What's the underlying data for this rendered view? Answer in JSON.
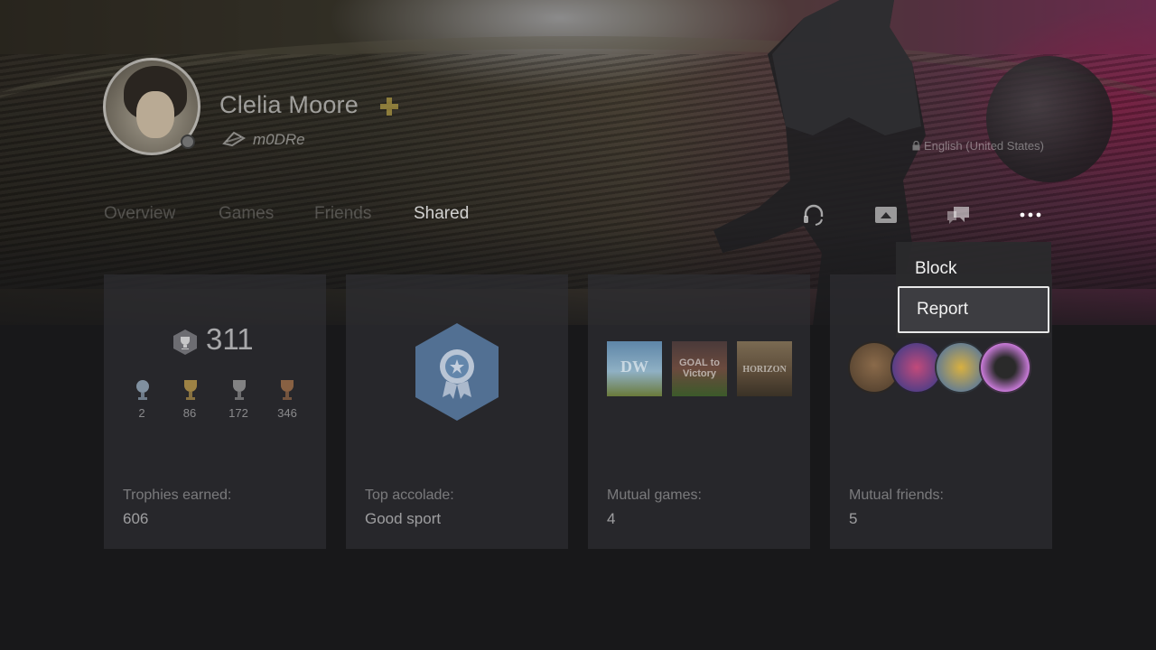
{
  "profile": {
    "name": "Clelia Moore",
    "online_id": "m0DRe",
    "language": "English (United States)"
  },
  "tabs": [
    {
      "label": "Overview",
      "active": false
    },
    {
      "label": "Games",
      "active": false
    },
    {
      "label": "Friends",
      "active": false
    },
    {
      "label": "Shared",
      "active": true
    }
  ],
  "actions": [
    "headset-icon",
    "share-screen-icon",
    "chat-icon",
    "more-icon"
  ],
  "menu": {
    "items": [
      {
        "label": "Block",
        "focused": false
      },
      {
        "label": "Report",
        "focused": true
      }
    ]
  },
  "cards": {
    "trophies": {
      "level": "311",
      "counts": [
        "2",
        "86",
        "172",
        "346"
      ],
      "label": "Trophies earned:",
      "value": "606"
    },
    "accolade": {
      "label": "Top accolade:",
      "value": "Good sport"
    },
    "games": {
      "thumbs": [
        "DW",
        "GOAL to Victory",
        "HORIZON"
      ],
      "label": "Mutual games:",
      "value": "4"
    },
    "friends": {
      "label": "Mutual friends:",
      "value": "5"
    }
  },
  "colors": {
    "accolade": "#5a7ea6",
    "plus": "#c9b04a",
    "platinum": "#9fb4c8",
    "gold": "#c6a24e",
    "silver": "#a9a9a9",
    "bronze": "#b27a4e"
  }
}
